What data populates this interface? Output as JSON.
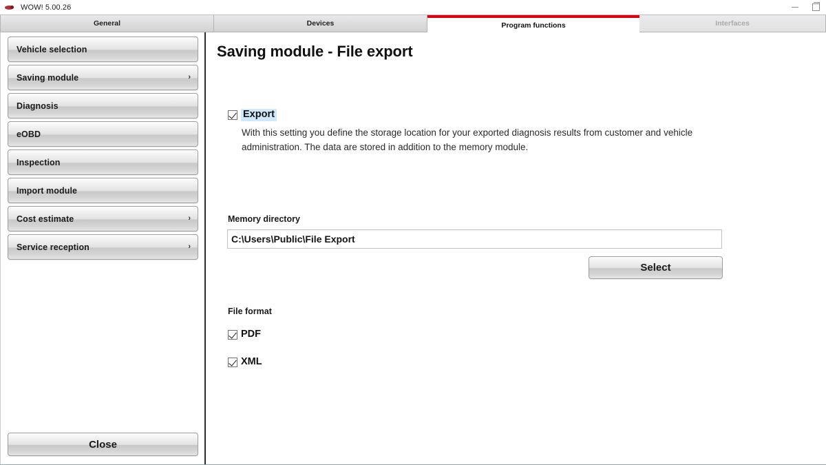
{
  "window": {
    "title": "WOW! 5.00.26",
    "app_icon": "wow-logo-icon",
    "minimize_label": "",
    "maximize_label": ""
  },
  "tabs": [
    {
      "id": "general",
      "label": "General",
      "state": "inactive"
    },
    {
      "id": "devices",
      "label": "Devices",
      "state": "inactive"
    },
    {
      "id": "progfunc",
      "label": "Program functions",
      "state": "active"
    },
    {
      "id": "interfaces",
      "label": "Interfaces",
      "state": "disabled"
    }
  ],
  "sidebar": {
    "items": [
      {
        "label": "Vehicle selection",
        "chevron": ""
      },
      {
        "label": "Saving module",
        "chevron": "›"
      },
      {
        "label": "Diagnosis",
        "chevron": ""
      },
      {
        "label": "eOBD",
        "chevron": ""
      },
      {
        "label": "Inspection",
        "chevron": ""
      },
      {
        "label": "Import module",
        "chevron": ""
      },
      {
        "label": "Cost estimate",
        "chevron": "›"
      },
      {
        "label": "Service reception",
        "chevron": "›"
      }
    ],
    "close_label": "Close"
  },
  "main": {
    "page_title": "Saving module - File export",
    "export": {
      "checkbox_label": "Export",
      "checked": true,
      "description": "With this setting you define the storage location for your exported diagnosis results from customer and vehicle administration. The data are stored in addition to the memory module."
    },
    "memory_directory": {
      "label": "Memory directory",
      "value": "C:\\Users\\Public\\File Export",
      "placeholder": "",
      "select_button_label": "Select"
    },
    "file_format": {
      "label": "File format",
      "options": [
        {
          "label": "PDF",
          "checked": true
        },
        {
          "label": "XML",
          "checked": true
        }
      ]
    }
  },
  "colors": {
    "accent_red": "#e2000f",
    "focus_highlight": "#cfe8fb",
    "divider": "#2b2b2b"
  }
}
